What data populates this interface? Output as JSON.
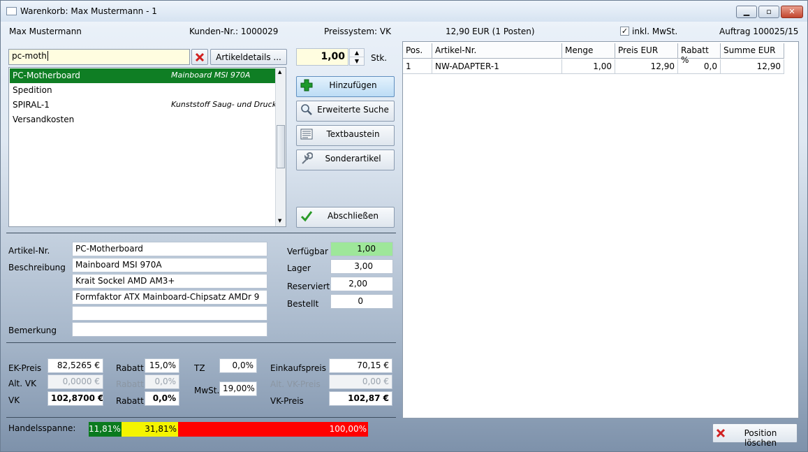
{
  "window": {
    "title": "Warenkorb: Max Mustermann - 1"
  },
  "header": {
    "customer": "Max Mustermann",
    "kunden_nr": "Kunden-Nr.: 1000029",
    "preissystem": "Preissystem: VK",
    "total": "12,90 EUR (1 Posten)",
    "inkl_mwst": "inkl. MwSt.",
    "auftrag": "Auftrag 100025/15"
  },
  "search": {
    "value": "pc-moth",
    "details_label": "Artikeldetails ..."
  },
  "quantity": {
    "value": "1,00",
    "unit": "Stk."
  },
  "article_list": [
    {
      "code": "PC-Motherboard",
      "desc": "Mainboard MSI 970A"
    },
    {
      "code": "Spedition",
      "desc": ""
    },
    {
      "code": "SPIRAL-1",
      "desc": "Kunststoff Saug- und Drucksch"
    },
    {
      "code": "Versandkosten",
      "desc": ""
    }
  ],
  "actions": {
    "add": "Hinzufügen",
    "extended_search": "Erweiterte Suche",
    "textbaustein": "Textbaustein",
    "sonderartikel": "Sonderartikel",
    "finish": "Abschließen"
  },
  "detail": {
    "artikel_nr_label": "Artikel-Nr.",
    "artikel_nr": "PC-Motherboard",
    "beschreibung_label": "Beschreibung",
    "beschreibung": [
      "Mainboard MSI 970A",
      "Krait Sockel AMD AM3+",
      "Formfaktor ATX Mainboard-Chipsatz AMDr 9",
      ""
    ],
    "bemerkung_label": "Bemerkung",
    "bemerkung": ""
  },
  "stock": {
    "verfuegbar_label": "Verfügbar",
    "verfuegbar": "1,00",
    "lager_label": "Lager",
    "lager": "3,00",
    "reserviert_label": "Reserviert",
    "reserviert": "2,00",
    "bestellt_label": "Bestellt",
    "bestellt": "0"
  },
  "pricing": {
    "ek_label": "EK-Preis",
    "ek": "82,5265 €",
    "alt_vk_label": "Alt. VK",
    "alt_vk": "0,0000 €",
    "vk_label": "VK",
    "vk": "102,8700 €",
    "rabatt_label": "Rabatt",
    "rabatt1": "15,0%",
    "rabatt2": "0,0%",
    "rabatt3": "0,0%",
    "tz_label": "TZ",
    "tz": "0,0%",
    "mwst_label": "MwSt.",
    "mwst": "19,00%",
    "einkaufspreis_label": "Einkaufspreis",
    "einkaufspreis": "70,15 €",
    "alt_vk_preis_label": "Alt. VK-Preis",
    "alt_vk_preis": "0,00 €",
    "vk_preis_label": "VK-Preis",
    "vk_preis": "102,87 €"
  },
  "margin": {
    "label": "Handelsspanne:",
    "segments": [
      {
        "text": "11,81%",
        "color": "#0a7a1e"
      },
      {
        "text": "31,81%",
        "color": "#f4f400"
      },
      {
        "text": "100,00%",
        "color": "#ff0000"
      }
    ]
  },
  "table": {
    "columns": [
      "Pos.",
      "Artikel-Nr.",
      "Menge",
      "Preis EUR",
      "Rabatt %",
      "Summe EUR"
    ],
    "rows": [
      [
        "1",
        "NW-ADAPTER-1",
        "1,00",
        "12,90",
        "0,0",
        "12,90"
      ]
    ]
  },
  "delete_button": "Position löschen"
}
